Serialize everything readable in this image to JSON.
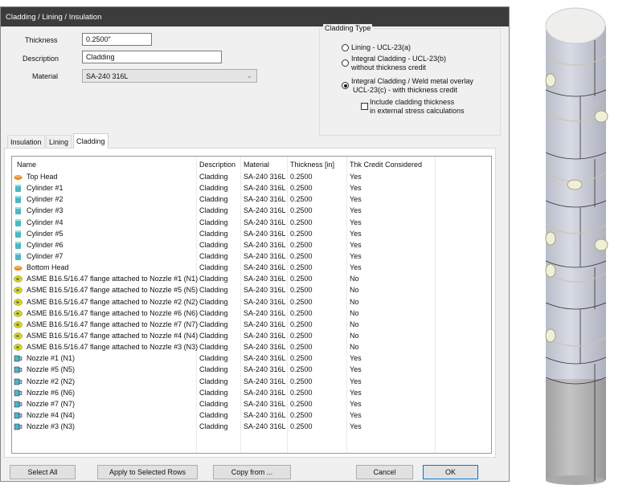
{
  "dialog": {
    "title": "Cladding / Lining / Insulation"
  },
  "form": {
    "thickness_label": "Thickness",
    "thickness_value": "0.2500\"",
    "description_label": "Description",
    "description_value": "Cladding",
    "material_label": "Material",
    "material_value": "SA-240 316L"
  },
  "cladding_type": {
    "title": "Cladding Type",
    "options": [
      {
        "line1": "Lining - UCL-23(a)",
        "line2": "",
        "selected": false
      },
      {
        "line1": "Integral Cladding - UCL-23(b)",
        "line2": "without thickness credit",
        "selected": false
      },
      {
        "line1": "Integral Cladding / Weld metal overlay",
        "line2": "UCL-23(c) - with thickness credit",
        "selected": true
      }
    ],
    "include_line1": "Include cladding thickness",
    "include_line2": "in external stress calculations",
    "include_checked": false
  },
  "tabs": [
    {
      "label": "Insulation"
    },
    {
      "label": "Lining"
    },
    {
      "label": "Cladding",
      "active": true
    }
  ],
  "table": {
    "columns": [
      "Name",
      "Description",
      "Material",
      "Thickness [in]",
      "Thk Credit Considered"
    ],
    "rows": [
      {
        "icon": "head",
        "name": "Top Head",
        "desc": "Cladding",
        "mat": "SA-240 316L",
        "thk": "0.2500",
        "credit": "Yes"
      },
      {
        "icon": "cylinder",
        "name": "Cylinder #1",
        "desc": "Cladding",
        "mat": "SA-240 316L",
        "thk": "0.2500",
        "credit": "Yes"
      },
      {
        "icon": "cylinder",
        "name": "Cylinder #2",
        "desc": "Cladding",
        "mat": "SA-240 316L",
        "thk": "0.2500",
        "credit": "Yes"
      },
      {
        "icon": "cylinder",
        "name": "Cylinder #3",
        "desc": "Cladding",
        "mat": "SA-240 316L",
        "thk": "0.2500",
        "credit": "Yes"
      },
      {
        "icon": "cylinder",
        "name": "Cylinder #4",
        "desc": "Cladding",
        "mat": "SA-240 316L",
        "thk": "0.2500",
        "credit": "Yes"
      },
      {
        "icon": "cylinder",
        "name": "Cylinder #5",
        "desc": "Cladding",
        "mat": "SA-240 316L",
        "thk": "0.2500",
        "credit": "Yes"
      },
      {
        "icon": "cylinder",
        "name": "Cylinder #6",
        "desc": "Cladding",
        "mat": "SA-240 316L",
        "thk": "0.2500",
        "credit": "Yes"
      },
      {
        "icon": "cylinder",
        "name": "Cylinder #7",
        "desc": "Cladding",
        "mat": "SA-240 316L",
        "thk": "0.2500",
        "credit": "Yes"
      },
      {
        "icon": "head",
        "name": "Bottom Head",
        "desc": "Cladding",
        "mat": "SA-240 316L",
        "thk": "0.2500",
        "credit": "Yes"
      },
      {
        "icon": "flange",
        "name": "ASME B16.5/16.47 flange attached to Nozzle #1 (N1)",
        "desc": "Cladding",
        "mat": "SA-240 316L",
        "thk": "0.2500",
        "credit": "No"
      },
      {
        "icon": "flange",
        "name": "ASME B16.5/16.47 flange attached to Nozzle #5 (N5)",
        "desc": "Cladding",
        "mat": "SA-240 316L",
        "thk": "0.2500",
        "credit": "No"
      },
      {
        "icon": "flange",
        "name": "ASME B16.5/16.47 flange attached to Nozzle #2 (N2)",
        "desc": "Cladding",
        "mat": "SA-240 316L",
        "thk": "0.2500",
        "credit": "No"
      },
      {
        "icon": "flange",
        "name": "ASME B16.5/16.47 flange attached to Nozzle #6 (N6)",
        "desc": "Cladding",
        "mat": "SA-240 316L",
        "thk": "0.2500",
        "credit": "No"
      },
      {
        "icon": "flange",
        "name": "ASME B16.5/16.47 flange attached to Nozzle #7 (N7)",
        "desc": "Cladding",
        "mat": "SA-240 316L",
        "thk": "0.2500",
        "credit": "No"
      },
      {
        "icon": "flange",
        "name": "ASME B16.5/16.47 flange attached to Nozzle #4 (N4)",
        "desc": "Cladding",
        "mat": "SA-240 316L",
        "thk": "0.2500",
        "credit": "No"
      },
      {
        "icon": "flange",
        "name": "ASME B16.5/16.47 flange attached to Nozzle #3 (N3)",
        "desc": "Cladding",
        "mat": "SA-240 316L",
        "thk": "0.2500",
        "credit": "No"
      },
      {
        "icon": "nozzle",
        "name": "Nozzle #1 (N1)",
        "desc": "Cladding",
        "mat": "SA-240 316L",
        "thk": "0.2500",
        "credit": "Yes"
      },
      {
        "icon": "nozzle",
        "name": "Nozzle #5 (N5)",
        "desc": "Cladding",
        "mat": "SA-240 316L",
        "thk": "0.2500",
        "credit": "Yes"
      },
      {
        "icon": "nozzle",
        "name": "Nozzle #2 (N2)",
        "desc": "Cladding",
        "mat": "SA-240 316L",
        "thk": "0.2500",
        "credit": "Yes"
      },
      {
        "icon": "nozzle",
        "name": "Nozzle #6 (N6)",
        "desc": "Cladding",
        "mat": "SA-240 316L",
        "thk": "0.2500",
        "credit": "Yes"
      },
      {
        "icon": "nozzle",
        "name": "Nozzle #7 (N7)",
        "desc": "Cladding",
        "mat": "SA-240 316L",
        "thk": "0.2500",
        "credit": "Yes"
      },
      {
        "icon": "nozzle",
        "name": "Nozzle #4 (N4)",
        "desc": "Cladding",
        "mat": "SA-240 316L",
        "thk": "0.2500",
        "credit": "Yes"
      },
      {
        "icon": "nozzle",
        "name": "Nozzle #3 (N3)",
        "desc": "Cladding",
        "mat": "SA-240 316L",
        "thk": "0.2500",
        "credit": "Yes"
      }
    ]
  },
  "buttons": {
    "select_all": "Select All",
    "apply": "Apply to Selected Rows",
    "copy": "Copy from ...",
    "cancel": "Cancel",
    "ok": "OK"
  },
  "colors": {
    "titlebar": "#3c3c3c",
    "ok_border": "#0078d7",
    "cylinder_icon": "#4fb6c2",
    "head_icon": "#e08a1e",
    "flange_icon": "#d8d81a"
  }
}
